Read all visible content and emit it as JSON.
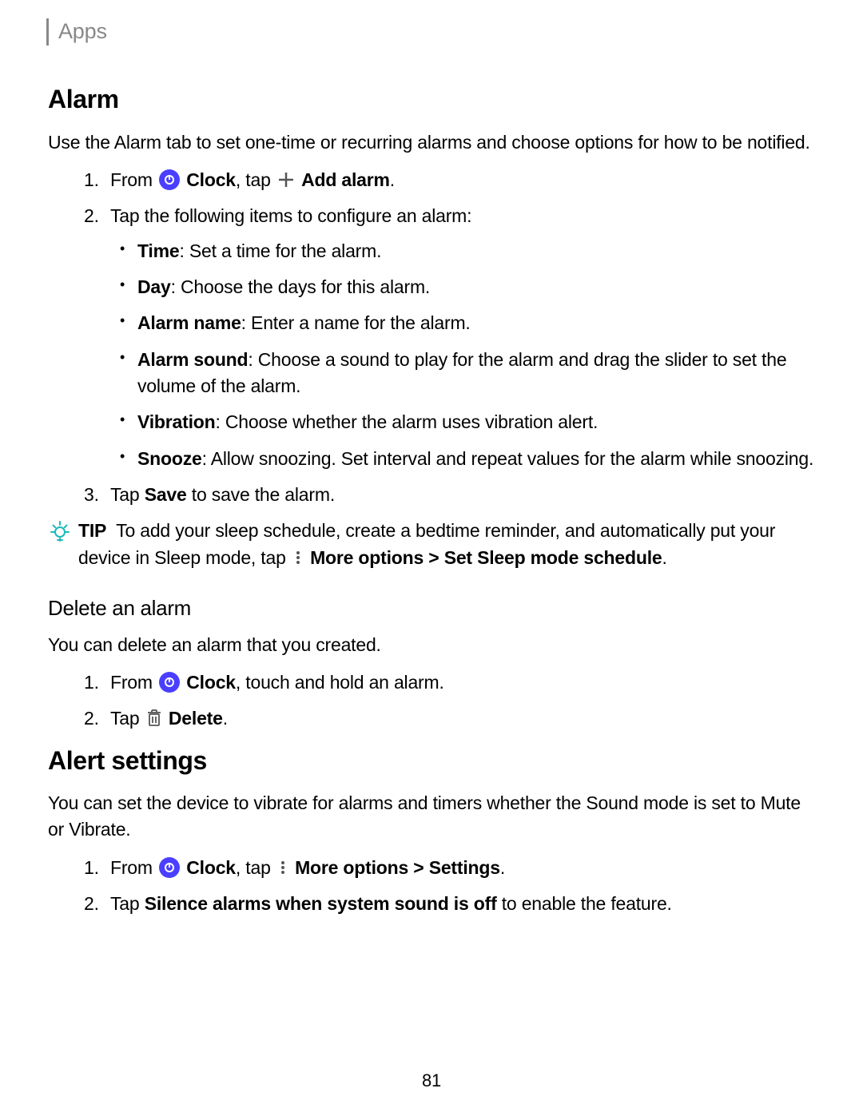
{
  "header": "Apps",
  "sections": {
    "alarm": {
      "title": "Alarm",
      "intro": "Use the Alarm tab to set one-time or recurring alarms and choose options for how to be notified.",
      "step1": {
        "from": "From",
        "clock": "Clock",
        "tap": ", tap",
        "add_alarm": "Add alarm",
        "period": "."
      },
      "step2_intro": "Tap the following items to configure an alarm:",
      "items": {
        "time": {
          "label": "Time",
          "text": ": Set a time for the alarm."
        },
        "day": {
          "label": "Day",
          "text": ": Choose the days for this alarm."
        },
        "alarm_name": {
          "label": "Alarm name",
          "text": ": Enter a name for the alarm."
        },
        "alarm_sound": {
          "label": "Alarm sound",
          "text": ": Choose a sound to play for the alarm and drag the slider to set the volume of the alarm."
        },
        "vibration": {
          "label": "Vibration",
          "text": ": Choose whether the alarm uses vibration alert."
        },
        "snooze": {
          "label": "Snooze",
          "text": ": Allow snoozing. Set interval and repeat values for the alarm while snoozing."
        }
      },
      "step3": {
        "pre": "Tap ",
        "bold": "Save",
        "post": " to save the alarm."
      },
      "tip": {
        "label": "TIP",
        "pre": "To add your sleep schedule, create a bedtime reminder, and automatically put your device in Sleep mode, tap",
        "more": "More options",
        "gt": ">",
        "set_sleep": "Set Sleep mode schedule",
        "period": "."
      }
    },
    "delete": {
      "title": "Delete an alarm",
      "intro": "You can delete an alarm that you created.",
      "step1": {
        "from": "From",
        "clock": "Clock",
        "rest": ", touch and hold an alarm."
      },
      "step2": {
        "tap": "Tap",
        "delete": "Delete",
        "period": "."
      }
    },
    "alert": {
      "title": "Alert settings",
      "intro": "You can set the device to vibrate for alarms and timers whether the Sound mode is set to Mute or Vibrate.",
      "step1": {
        "from": "From",
        "clock": "Clock",
        "tap": ", tap",
        "more": "More options",
        "gt": ">",
        "settings": "Settings",
        "period": "."
      },
      "step2": {
        "pre": "Tap ",
        "bold": "Silence alarms when system sound is off",
        "post": " to enable the feature."
      }
    }
  },
  "page_number": "81"
}
